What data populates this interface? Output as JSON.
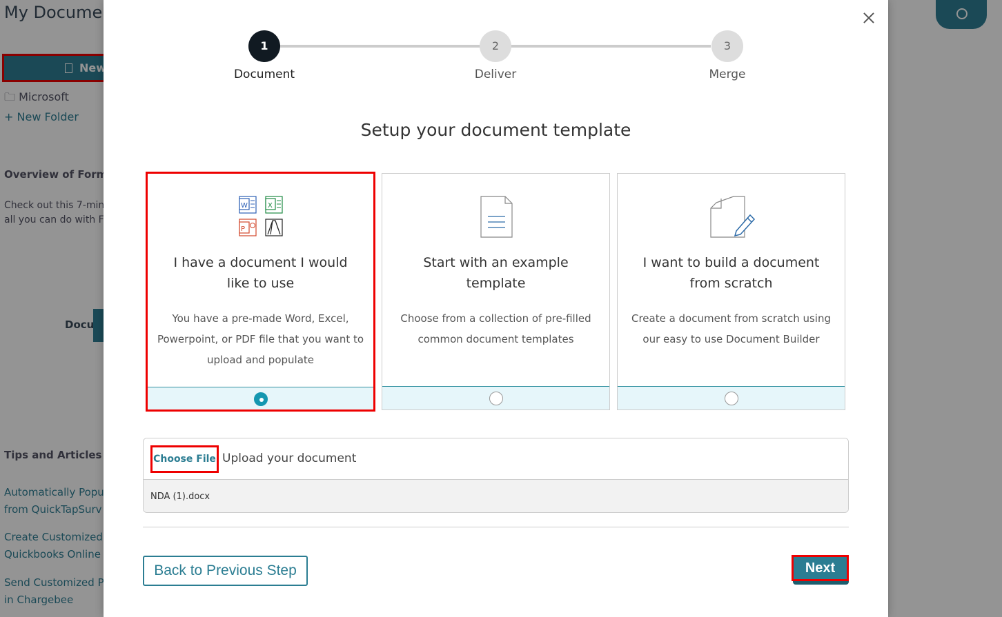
{
  "background": {
    "title": "My Documents",
    "new_button_label": "New",
    "folders": [
      "Microsoft"
    ],
    "new_folder_label": "New Folder",
    "overview_heading": "Overview of Forms",
    "overview_text_line1": "Check out this 7-min",
    "overview_text_line2": "all you can do with F",
    "video_label": "Docu",
    "tips_heading": "Tips and Articles",
    "articles": [
      {
        "line1": "Automatically Popu",
        "line2": "from QuickTapSurv"
      },
      {
        "line1": "Create Customized",
        "line2": "Quickbooks Online"
      },
      {
        "line1": "Send Customized P",
        "line2": "in Chargebee"
      }
    ]
  },
  "modal": {
    "steps": [
      {
        "number": "1",
        "label": "Document",
        "active": true
      },
      {
        "number": "2",
        "label": "Deliver",
        "active": false
      },
      {
        "number": "3",
        "label": "Merge",
        "active": false
      }
    ],
    "title": "Setup your document template",
    "options": [
      {
        "title": "I have a document I would like to use",
        "description": "You have a pre-made Word, Excel, Powerpoint, or PDF file that you want to upload and populate",
        "icon": "office-file-icons",
        "selected": true
      },
      {
        "title": "Start with an example template",
        "description": "Choose from a collection of pre-filled common document templates",
        "icon": "document-icon",
        "selected": false
      },
      {
        "title": "I want to build a document from scratch",
        "description": "Create a document from scratch using our easy to use Document Builder",
        "icon": "document-edit-icon",
        "selected": false
      }
    ],
    "upload": {
      "choose_file_label": "Choose File",
      "label": "Upload your document",
      "file_name": "NDA (1).docx"
    },
    "back_label": "Back to Previous Step",
    "next_label": "Next"
  },
  "colors": {
    "accent": "#2b7d92",
    "selected_radio": "#1497b0",
    "highlight_outline": "#e00000"
  }
}
